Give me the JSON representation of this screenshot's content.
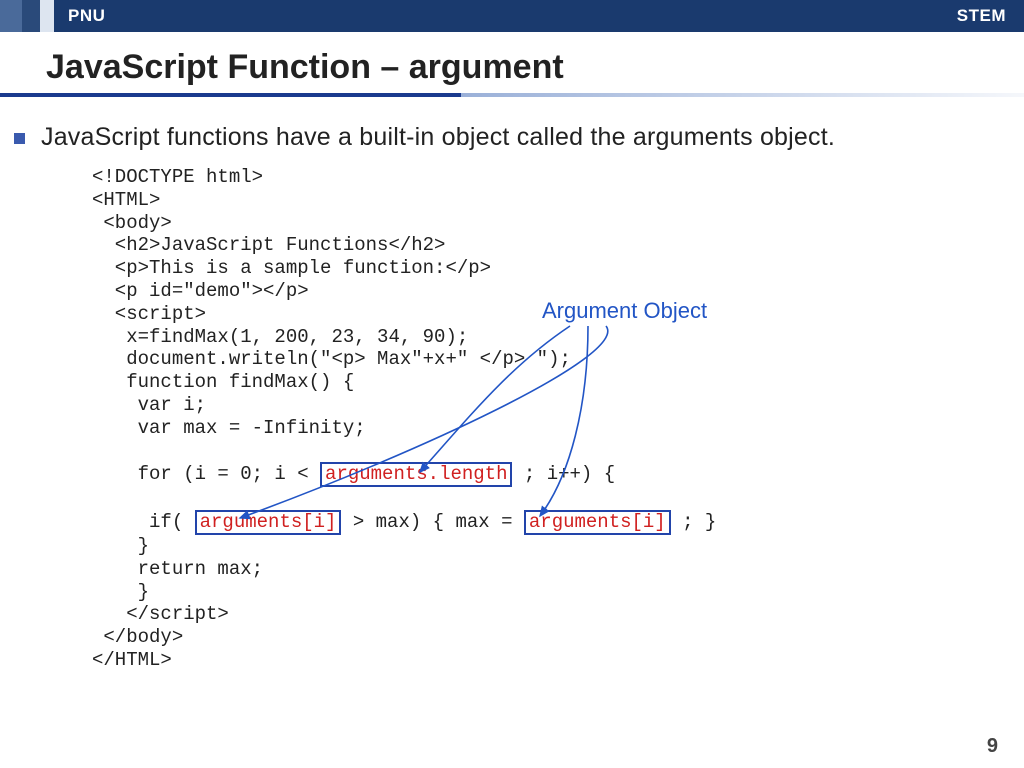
{
  "header": {
    "left": "PNU",
    "right": "STEM"
  },
  "title": "JavaScript Function – argument",
  "bullet": "JavaScript functions have a built-in object called the arguments object.",
  "code": {
    "l01": "<!DOCTYPE html>",
    "l02": "<HTML>",
    "l03": " <body>",
    "l04": "  <h2>JavaScript Functions</h2>",
    "l05": "  <p>This is a sample function:</p>",
    "l06": "  <p id=\"demo\"></p>",
    "l07": "  <script>",
    "l08": "   x=findMax(1, 200, 23, 34, 90);",
    "l09": "   document.writeln(\"<p> Max\"+x+\" </p> \");",
    "l10": "   function findMax() {",
    "l11": "    var i;",
    "l12": "    var max = -Infinity;",
    "l13_a": "    for (i = 0; i < ",
    "l13_box": "arguments.length",
    "l13_b": " ; i++) {",
    "l14_a": "     if( ",
    "l14_box1": "arguments[i]",
    "l14_b": " > max) { max = ",
    "l14_box2": "arguments[i]",
    "l14_c": " ; }",
    "l15": "    }",
    "l16": "    return max;",
    "l17": "    }",
    "l18": "   </script>",
    "l19": " </body>",
    "l20": "</HTML>"
  },
  "annotation": "Argument Object",
  "page_number": "9"
}
